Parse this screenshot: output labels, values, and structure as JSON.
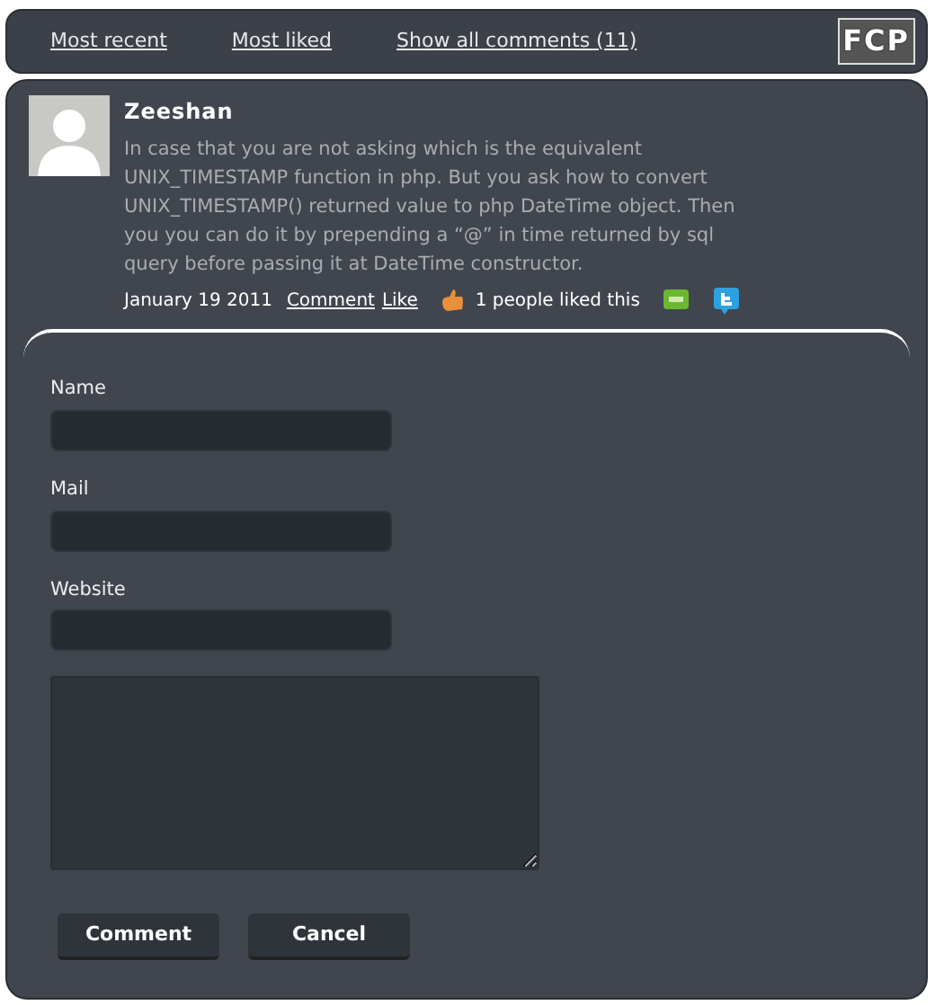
{
  "nav": {
    "links": [
      "Most recent",
      "Most liked",
      "Show all comments (11)"
    ],
    "logo": "FCP"
  },
  "comment": {
    "author": "Zeeshan",
    "text": "In case that you are not asking which is the equivalent UNIX_TIMESTAMP function in php. But you ask how to convert UNIX_TIMESTAMP() returned value to php DateTime object. Then you you can do it by prepending a “@” in time returned by sql query before passing it at DateTime constructor.",
    "date": "January 19 2011",
    "actions": [
      "Comment",
      "Like"
    ],
    "likes": "1 people liked this"
  },
  "form": {
    "fields": [
      {
        "label": "Name"
      },
      {
        "label": "Mail"
      },
      {
        "label": "Website"
      }
    ],
    "buttons": [
      "Comment",
      "Cancel"
    ]
  }
}
